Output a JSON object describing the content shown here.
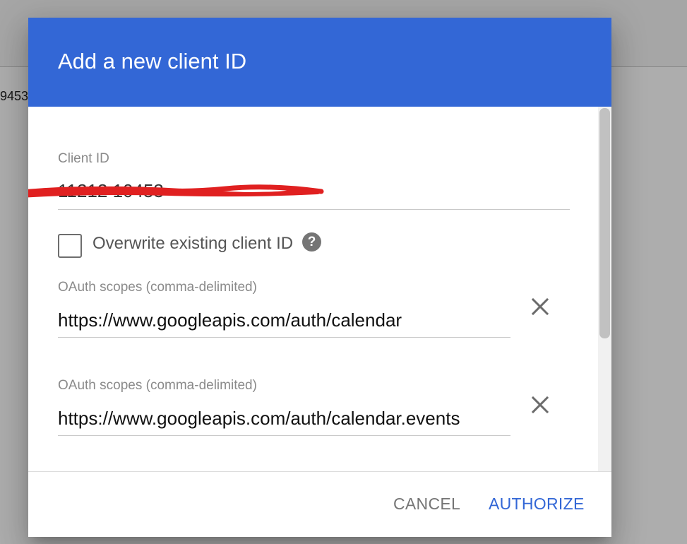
{
  "background": {
    "partial_text": "9453"
  },
  "dialog": {
    "title": "Add a new client ID",
    "client_id": {
      "label": "Client ID",
      "value": "11212        10453"
    },
    "overwrite": {
      "label": "Overwrite existing client ID",
      "checked": false,
      "help_glyph": "?"
    },
    "scopes": [
      {
        "label": "OAuth scopes (comma-delimited)",
        "value": "https://www.googleapis.com/auth/calendar"
      },
      {
        "label": "OAuth scopes (comma-delimited)",
        "value": "https://www.googleapis.com/auth/calendar.events"
      }
    ],
    "buttons": {
      "cancel": "CANCEL",
      "authorize": "AUTHORIZE"
    }
  },
  "colors": {
    "header": "#3367d6",
    "accent": "#3367d6",
    "redaction": "#e02020"
  },
  "icons": {
    "close": "close-icon",
    "help": "help-icon"
  }
}
